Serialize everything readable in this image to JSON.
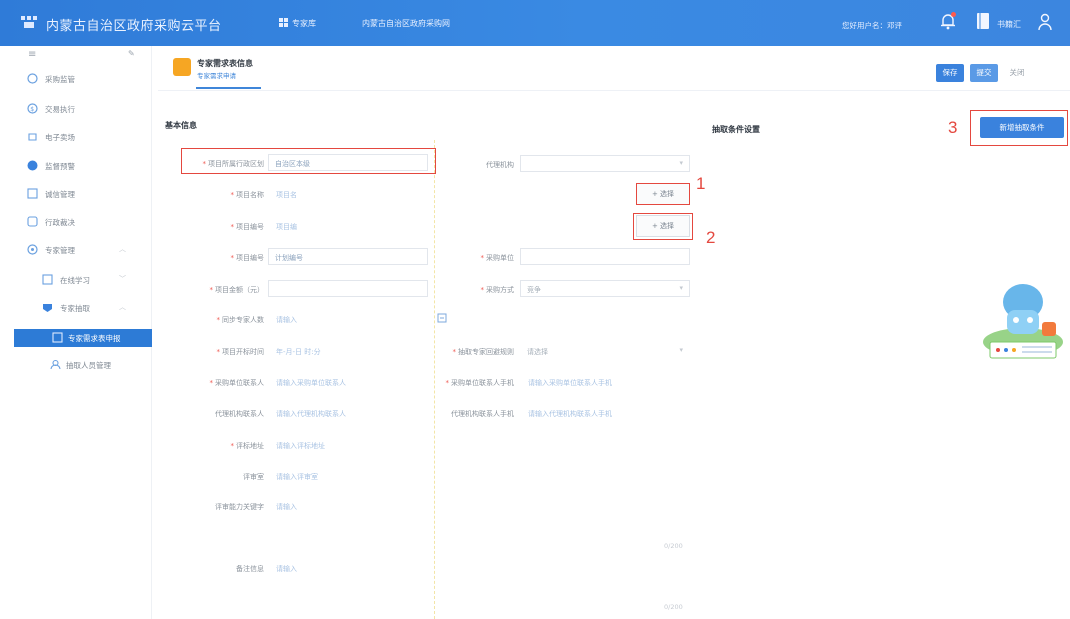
{
  "topbar": {
    "app_title": "内蒙古自治区政府采购云平台",
    "nav_item": "专家库",
    "nav_link": "内蒙古自治区政府采购网",
    "user_info": "您好用户名：邓评",
    "book_label": "书籍汇"
  },
  "sidebar": {
    "collapse_glyph": "≡",
    "pin_glyph": "✎",
    "items": [
      {
        "label": "采购监管",
        "icon": "shield-icon"
      },
      {
        "label": "交易执行",
        "icon": "transaction-icon"
      },
      {
        "label": "电子卖场",
        "icon": "store-icon"
      },
      {
        "label": "监督预警",
        "icon": "alert-icon"
      },
      {
        "label": "诚信管理",
        "icon": "credit-icon"
      },
      {
        "label": "行政裁决",
        "icon": "gavel-icon"
      },
      {
        "label": "专家管理",
        "icon": "expert-icon"
      },
      {
        "label": "在线学习",
        "icon": "study-icon"
      },
      {
        "label": "专家抽取",
        "icon": "draw-icon"
      },
      {
        "label": "专家需求表申报",
        "icon": "form-icon"
      },
      {
        "label": "抽取人员管理",
        "icon": "people-icon"
      }
    ]
  },
  "header": {
    "title": "专家需求表信息",
    "subtitle": "专家需求申请",
    "buttons": {
      "save": "保存",
      "submit": "提交",
      "close": "关闭"
    }
  },
  "form": {
    "section_basic": "基本信息",
    "section_conditions": "抽取条件设置",
    "add_condition_label": "新增抽取条件",
    "fields": {
      "region_label": "项目所属行政区划",
      "region_value": "自治区本级",
      "agency_label": "代理机构",
      "project_name_label": "项目名称",
      "project_name_value": "项目名",
      "project_code_label": "项目编号",
      "project_code_value": "项目编",
      "pick_label": "+ 选择",
      "plan_no_label": "项目编号",
      "plan_no_value": "计划编号",
      "purchase_unit_label": "采购单位",
      "budget_label": "项目金额（元）",
      "method_label": "采购方式",
      "method_value": "竞争",
      "review_people_label": "同步专家人数",
      "review_people_value": "请输入",
      "time_label": "项目开标时间",
      "time_value": "年-月-日 时:分",
      "rule_label": "抽取专家回避规则",
      "rule_value": "请选择",
      "contact_label": "采购单位联系人",
      "contact_value": "请输入采购单位联系人",
      "contact_phone_label": "采购单位联系人手机",
      "contact_phone_value": "请输入采购单位联系人手机",
      "agent_contact_label": "代理机构联系人",
      "agent_contact_value": "请输入代理机构联系人",
      "agent_phone_label": "代理机构联系人手机",
      "agent_phone_value": "请输入代理机构联系人手机",
      "address_label": "评标地址",
      "address_value": "请输入评标地址",
      "room_label": "评审室",
      "room_value": "请输入评审室",
      "ability_label": "评审能力关键字",
      "ability_value": "请输入",
      "note_label": "备注信息",
      "note_value": "请输入",
      "ghost_a": "0/200",
      "ghost_b": "0/200"
    }
  },
  "annotations": {
    "one": "1",
    "two": "2",
    "three": "3"
  }
}
